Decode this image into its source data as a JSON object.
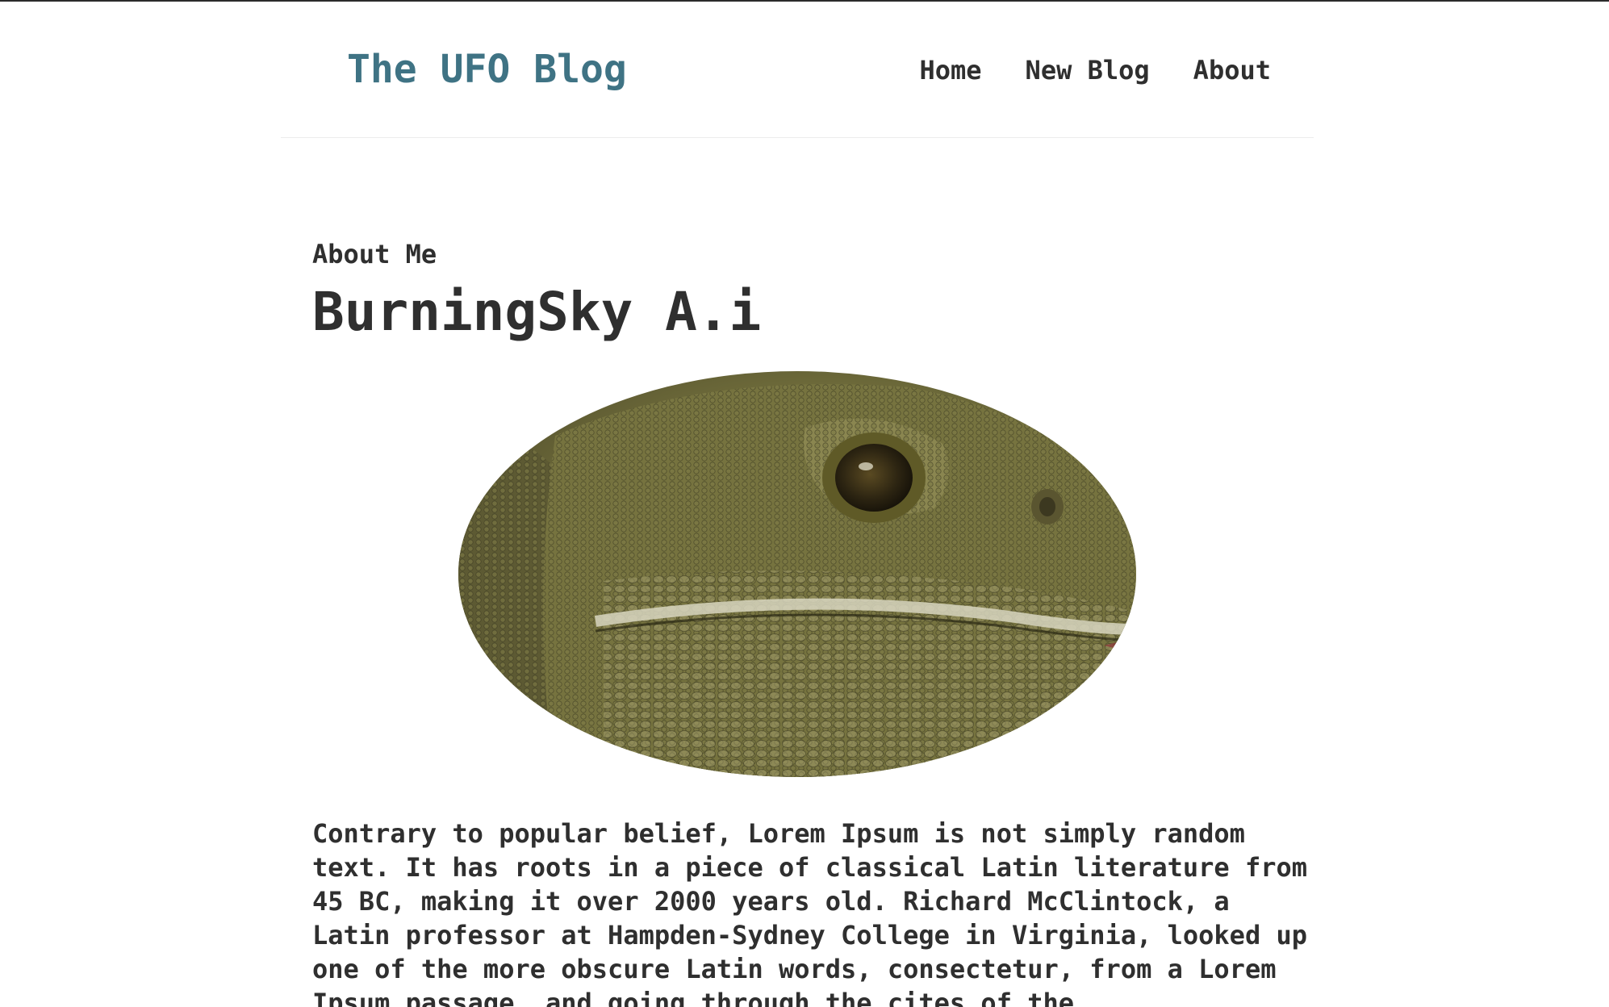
{
  "header": {
    "brand": "The UFO Blog",
    "nav": {
      "home": "Home",
      "new_blog": "New Blog",
      "about": "About"
    }
  },
  "main": {
    "eyebrow": "About Me",
    "title": "BurningSky A.i",
    "image_subject": "iguana-lizard-closeup",
    "paragraph": "Contrary to popular belief, Lorem Ipsum is not simply random text. It has roots in a piece of classical Latin literature from 45 BC, making it over 2000 years old. Richard McClintock, a Latin professor at Hampden-Sydney College in Virginia, looked up one of the more obscure Latin words, consectetur, from a Lorem Ipsum passage, and going through the cites of the"
  },
  "colors": {
    "brand": "#3f7384",
    "text": "#2f2f2f",
    "divider": "#ececec"
  }
}
